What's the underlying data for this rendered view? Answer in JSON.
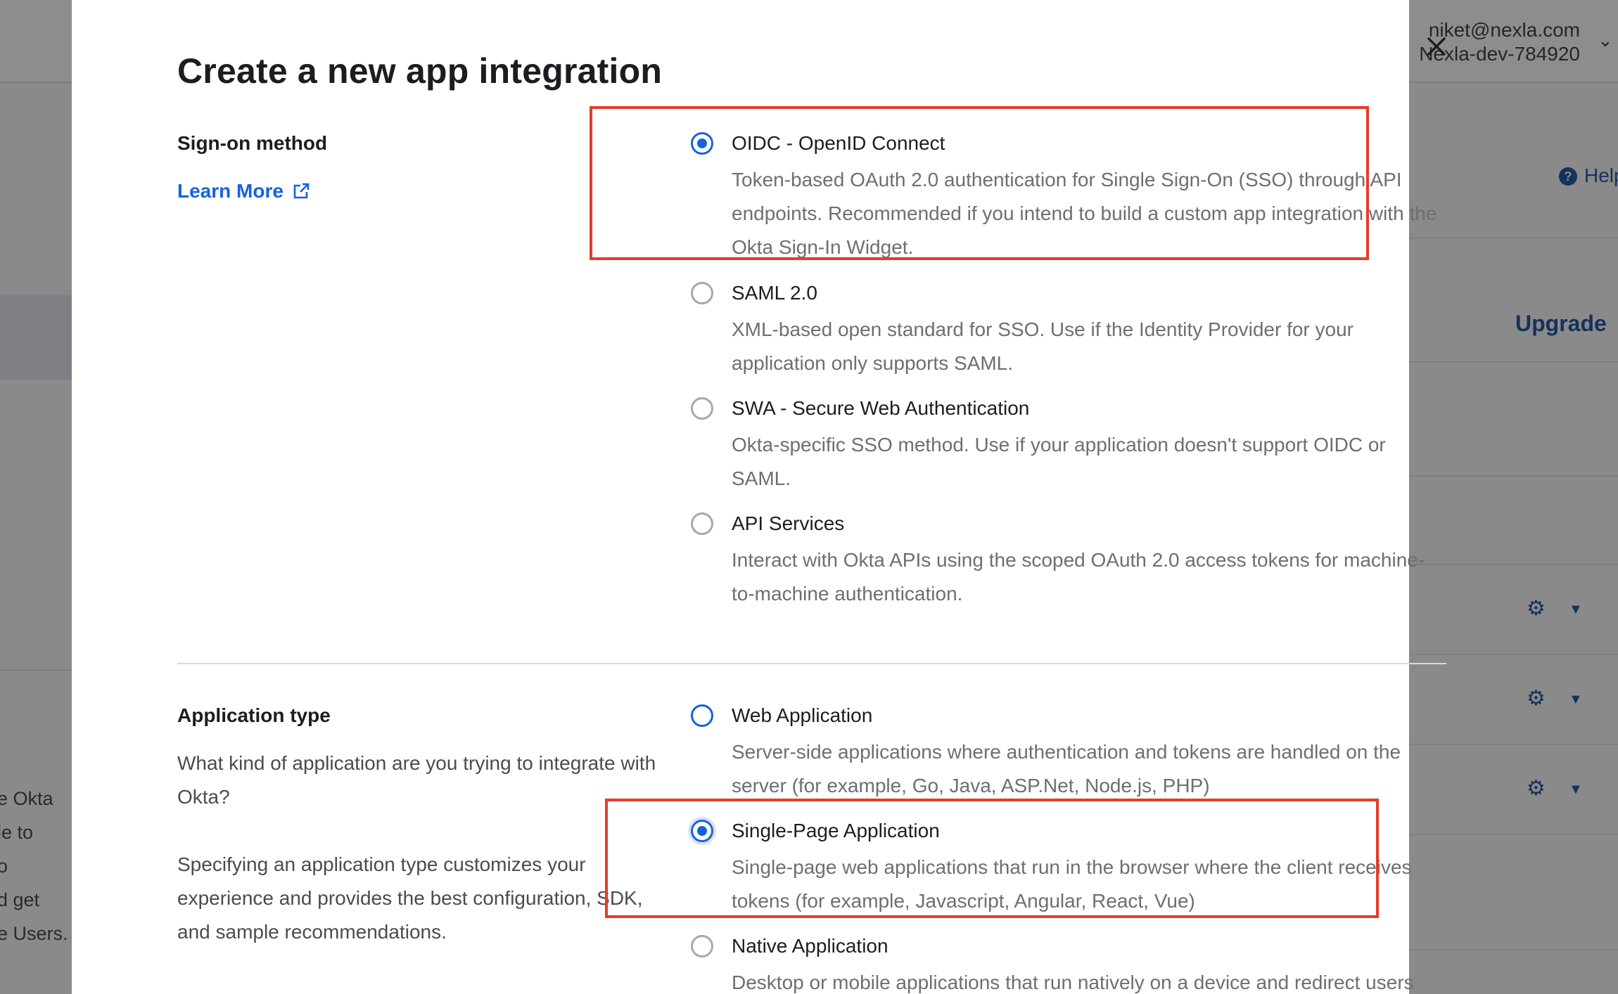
{
  "background": {
    "user_email": "niket@nexla.com",
    "org_name": "Nexla-dev-784920",
    "help_label": "Help",
    "upgrade_label": "Upgrade",
    "left_fragments": [
      "e Okta",
      "le to",
      "o",
      "d get",
      "e Users."
    ]
  },
  "modal": {
    "title": "Create a new app integration",
    "close_label": "×"
  },
  "sign_on": {
    "label": "Sign-on method",
    "learn_more": "Learn More",
    "options": [
      {
        "title": "OIDC - OpenID Connect",
        "description": "Token-based OAuth 2.0 authentication for Single Sign-On (SSO) through API endpoints. Recommended if you intend to build a custom app integration with the Okta Sign-In Widget.",
        "selected": true
      },
      {
        "title": "SAML 2.0",
        "description": "XML-based open standard for SSO. Use if the Identity Provider for your application only supports SAML.",
        "selected": false
      },
      {
        "title": "SWA - Secure Web Authentication",
        "description": "Okta-specific SSO method. Use if your application doesn't support OIDC or SAML.",
        "selected": false
      },
      {
        "title": "API Services",
        "description": "Interact with Okta APIs using the scoped OAuth 2.0 access tokens for machine-to-machine authentication.",
        "selected": false
      }
    ]
  },
  "app_type": {
    "label": "Application type",
    "desc1": "What kind of application are you trying to integrate with Okta?",
    "desc2": "Specifying an application type customizes your experience and provides the best configuration, SDK, and sample recommendations.",
    "options": [
      {
        "title": "Web Application",
        "description": "Server-side applications where authentication and tokens are handled on the server (for example, Go, Java, ASP.Net, Node.js, PHP)",
        "selected": false
      },
      {
        "title": "Single-Page Application",
        "description": "Single-page web applications that run in the browser where the client receives tokens (for example, Javascript, Angular, React, Vue)",
        "selected": true
      },
      {
        "title": "Native Application",
        "description": "Desktop or mobile applications that run natively on a device and redirect users",
        "selected": false
      }
    ]
  },
  "colors": {
    "accent": "#1662dd",
    "highlight": "#e43d2b"
  }
}
